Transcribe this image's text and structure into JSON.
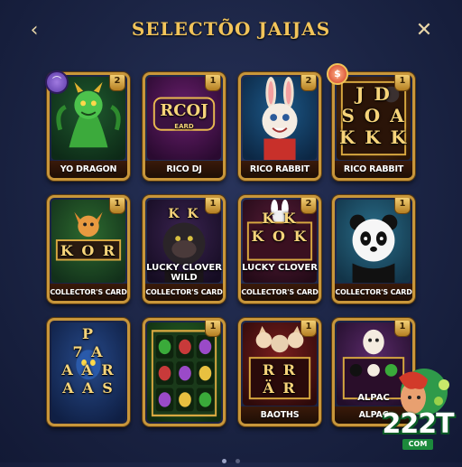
{
  "header": {
    "title": "SELECTÕO JAIJAS",
    "back_glyph": "‹",
    "close_glyph": "✕"
  },
  "cards": [
    {
      "label": "YO DRAGON",
      "badge": "2",
      "theme": "dragon"
    },
    {
      "label": "RICO DJ",
      "badge": "1",
      "theme": "ricodj",
      "art_text": "RCOJ",
      "art_sub": "EARD"
    },
    {
      "label": "RICO RABBIT",
      "badge": "2",
      "theme": "rabbit"
    },
    {
      "label": "RICO RABBIT",
      "badge": "1",
      "theme": "letters",
      "art_rows": [
        "J  D",
        "S O A",
        "K K K"
      ]
    },
    {
      "label": "COLLECTOR'S CARD",
      "badge": "1",
      "theme": "fox",
      "art_rows": [
        "K  O  R"
      ]
    },
    {
      "label": "COLLECTOR'S CARD",
      "badge": "1",
      "theme": "gorilla",
      "art_rows": [
        "K  K"
      ],
      "overlay": [
        "LUCKY CLOVER",
        "WILD"
      ]
    },
    {
      "label": "COLLECTOR'S CARD",
      "badge": "2",
      "theme": "clover",
      "art_rows": [
        "K  K",
        "K O K"
      ],
      "overlay": [
        "LUCKY CLOVER"
      ]
    },
    {
      "label": "COLLECTOR'S CARD",
      "badge": "1",
      "theme": "panda"
    },
    {
      "label": "",
      "badge": "",
      "theme": "slots-blue",
      "art_rows": [
        "P",
        "7  A",
        "A A R",
        "A A S"
      ]
    },
    {
      "label": "",
      "badge": "1",
      "theme": "slots-green"
    },
    {
      "label": "BAOTHS",
      "badge": "1",
      "theme": "cats",
      "art_rows": [
        "R  R",
        "Ä  R"
      ]
    },
    {
      "label": "ALPAC",
      "label2": "ALPAC",
      "badge": "1",
      "theme": "alpaca"
    }
  ],
  "pager": {
    "pages": 2,
    "active": 0
  },
  "brand": {
    "text": "222T",
    "sub": "COM"
  },
  "colors": {
    "gold": "#f2c45a",
    "frame": "#c8963a",
    "bg": "#1b2444"
  }
}
